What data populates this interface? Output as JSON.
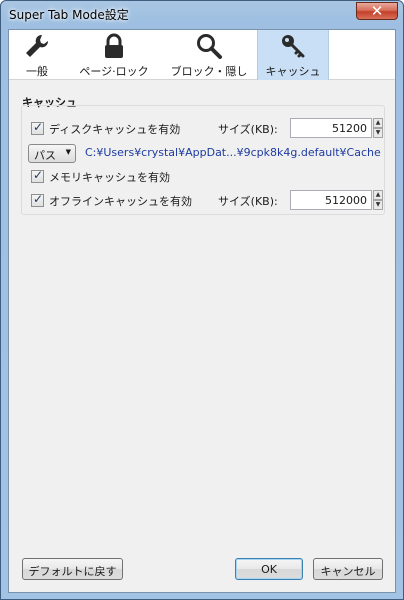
{
  "window": {
    "title": "Super Tab Mode設定",
    "close_glyph": "✕"
  },
  "tabs": [
    {
      "label": "一般",
      "icon": "wrench-icon"
    },
    {
      "label": "ページ·ロック",
      "icon": "lock-icon"
    },
    {
      "label": "ブロック・隠し",
      "icon": "magnifier-icon"
    },
    {
      "label": "キャッシュ",
      "icon": "key-icon",
      "active": true
    }
  ],
  "cache": {
    "group_title": "キャッシュ",
    "disk": {
      "label": "ディスクキャッシュを有効",
      "checked": true,
      "size_label": "サイズ(KB):",
      "size_value": "51200"
    },
    "path": {
      "button_label": "パス",
      "value": "C:¥Users¥crystal¥AppDat...¥9cpk8k4g.default¥Cache"
    },
    "memory": {
      "label": "メモリキャッシュを有効",
      "checked": true
    },
    "offline": {
      "label": "オフラインキャッシュを有効",
      "checked": true,
      "size_label": "サイズ(KB):",
      "size_value": "512000"
    }
  },
  "buttons": {
    "default": "デフォルトに戻す",
    "ok": "OK",
    "cancel": "キャンセル"
  },
  "colors": {
    "accent": "#c9dff5",
    "path_text": "#1d3ba0",
    "title_bar": "#a9c6e3"
  }
}
